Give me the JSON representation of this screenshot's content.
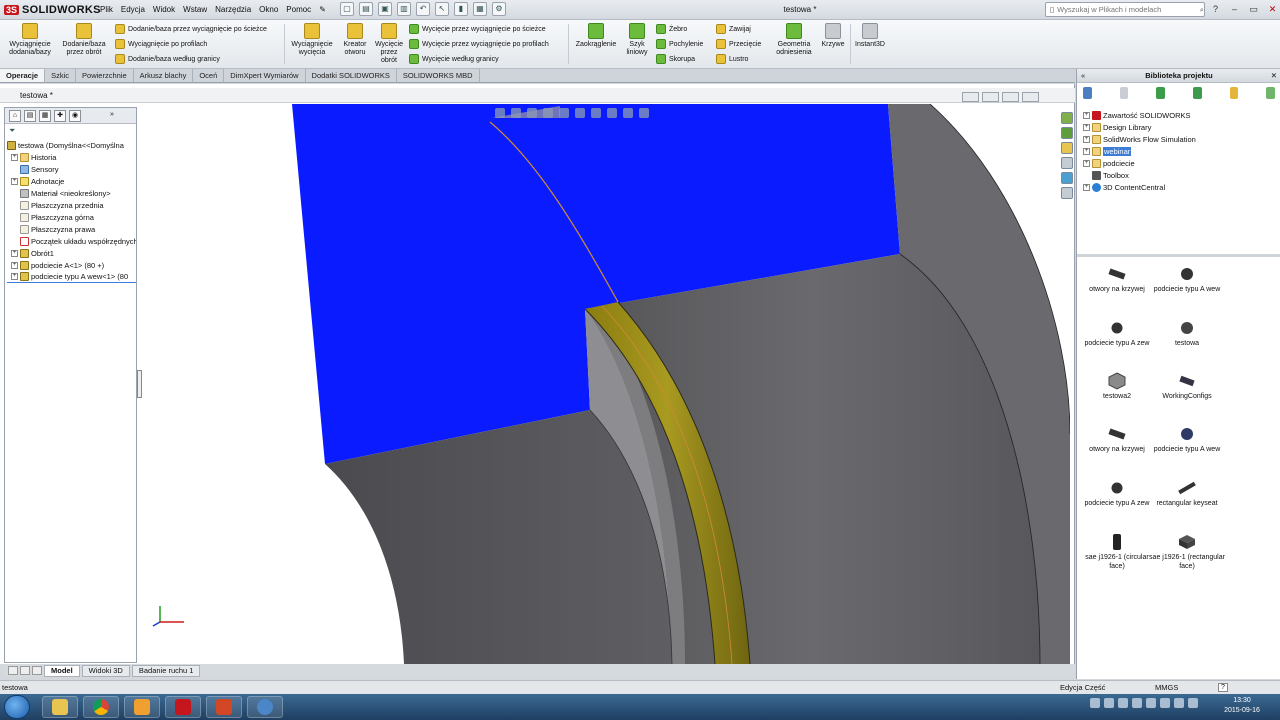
{
  "app": {
    "brand": "SOLIDWORKS",
    "doc_title": "testowa *"
  },
  "menu": [
    "Plik",
    "Edycja",
    "Widok",
    "Wstaw",
    "Narzędzia",
    "Okno",
    "Pomoc"
  ],
  "search": {
    "placeholder": "Wyszukaj w Plikach i modelach"
  },
  "ribbon": {
    "wyciagniecie_dodanie": "Wyciągnięcie dodania/bazy",
    "dodanie_przez_obrot": "Dodanie/baza przez obrót",
    "dodanie_sciezka": "Dodanie/baza przez wyciągnięcie po ścieżce",
    "wyciagniecie_profilach": "Wyciągnięcie po profilach",
    "dodanie_granicy": "Dodanie/baza według granicy",
    "wyciagniecie_wyciecia": "Wyciągnięcie wycięcia",
    "kreator_otworu": "Kreator otworu",
    "wyciecie_przez_obrot": "Wycięcie przez obrót",
    "wyciecie_sciezka": "Wycięcie przez wyciągnięcie po ścieżce",
    "wyciecie_profilach": "Wycięcie przez wyciągnięcie po profilach",
    "wyciecie_granicy": "Wycięcie według granicy",
    "zaokraglenie": "Zaokrąglenie",
    "szyk_liniowy": "Szyk liniowy",
    "zebro": "Żebro",
    "pochylenie": "Pochylenie",
    "skorupa": "Skorupa",
    "zawijaj": "Zawijaj",
    "przeciecie": "Przecięcie",
    "lustro": "Lustro",
    "geometria_odniesienia": "Geometria odniesienia",
    "krzywe": "Krzywe",
    "instant3d": "Instant3D"
  },
  "tabs": [
    "Operacje",
    "Szkic",
    "Powierzchnie",
    "Arkusz blachy",
    "Oceń",
    "DimXpert Wymiarów",
    "Dodatki SOLIDWORKS",
    "SOLIDWORKS MBD"
  ],
  "document": {
    "name": "testowa *"
  },
  "feature_tree": {
    "root": "testowa  (Domyślna<<Domyślna",
    "items": [
      {
        "label": "Historia",
        "icon": "folder-icon",
        "expandable": true
      },
      {
        "label": "Sensory",
        "icon": "sensor-icon",
        "expandable": false
      },
      {
        "label": "Adnotacje",
        "icon": "annotation-icon",
        "expandable": true
      },
      {
        "label": "Materiał <nieokreślony>",
        "icon": "material-icon",
        "expandable": false
      },
      {
        "label": "Płaszczyzna przednia",
        "icon": "plane-icon",
        "expandable": false
      },
      {
        "label": "Płaszczyzna górna",
        "icon": "plane-icon",
        "expandable": false
      },
      {
        "label": "Płaszczyzna prawa",
        "icon": "plane-icon",
        "expandable": false
      },
      {
        "label": "Początek układu współrzędnych",
        "icon": "origin-icon",
        "expandable": false
      },
      {
        "label": "Obrót1",
        "icon": "revolve-icon",
        "expandable": true
      },
      {
        "label": "podciecie A<1> (80 +)",
        "icon": "library-feature-icon",
        "expandable": true
      },
      {
        "label": "podciecie typu A wew<1> (80",
        "icon": "library-feature-icon",
        "expandable": true
      }
    ]
  },
  "bottom_tabs": [
    "Model",
    "Widoki 3D",
    "Badanie ruchu 1"
  ],
  "status": {
    "left": "testowa",
    "mode": "Edycja Część",
    "units": "MMGS",
    "help": "?"
  },
  "clock": {
    "time": "13:30",
    "date": "2015-09-16"
  },
  "library": {
    "title": "Biblioteka projektu",
    "tree": [
      {
        "label": "Zawartość SOLIDWORKS",
        "selected": false
      },
      {
        "label": "Design Library",
        "selected": false
      },
      {
        "label": "SolidWorks Flow Simulation",
        "selected": false
      },
      {
        "label": "webinar",
        "selected": true
      },
      {
        "label": "podciecie",
        "selected": false
      },
      {
        "label": "Toolbox",
        "selected": false
      },
      {
        "label": "3D ContentCentral",
        "selected": false
      }
    ],
    "items": [
      {
        "label": "otwory na krzywej",
        "icon": "bar-part-icon"
      },
      {
        "label": "podciecie typu A wew",
        "icon": "round-part-icon"
      },
      {
        "label": "podciecie typu A zew",
        "icon": "round-part-icon"
      },
      {
        "label": "testowa",
        "icon": "round-part-icon"
      },
      {
        "label": "testowa2",
        "icon": "cube-part-icon"
      },
      {
        "label": "WorkingConfigs",
        "icon": "config-part-icon"
      },
      {
        "label": "otwory na krzywej",
        "icon": "bar-part-icon"
      },
      {
        "label": "podciecie typu A wew",
        "icon": "blue-round-part-icon"
      },
      {
        "label": "podciecie typu A zew",
        "icon": "round-part-icon"
      },
      {
        "label": "rectangular keyseat",
        "icon": "keyseat-part-icon"
      },
      {
        "label": "sae j1926-1 (circular face)",
        "icon": "cylinder-part-icon"
      },
      {
        "label": "sae j1926-1 (rectangular face)",
        "icon": "cube-part-icon"
      }
    ]
  }
}
